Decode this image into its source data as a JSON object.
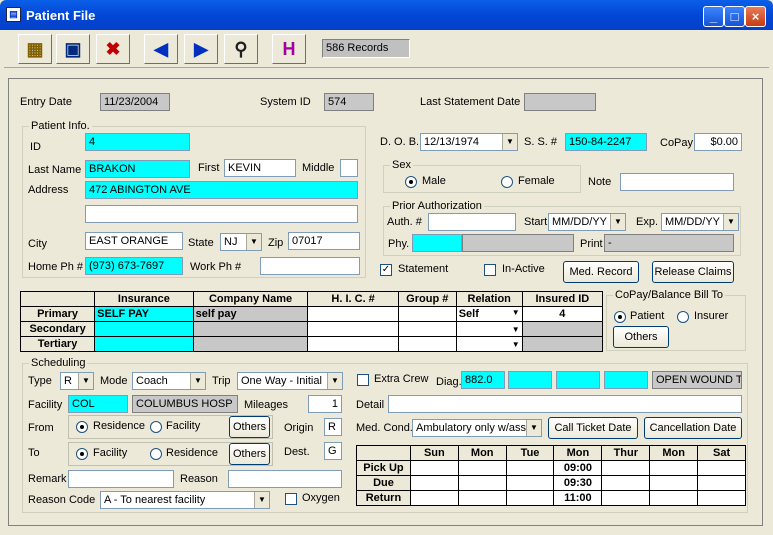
{
  "window": {
    "title": "Patient File"
  },
  "toolbar": {
    "records": "586 Records"
  },
  "header": {
    "entry_date_label": "Entry Date",
    "entry_date": "11/23/2004",
    "system_id_label": "System ID",
    "system_id": "574",
    "last_stmt_label": "Last Statement Date",
    "last_stmt": ""
  },
  "patient": {
    "group": "Patient Info.",
    "id_label": "ID",
    "id": "4",
    "last_name_label": "Last Name",
    "last_name": "BRAKON",
    "first_label": "First",
    "first": "KEVIN",
    "middle_label": "Middle",
    "middle": "",
    "address_label": "Address",
    "address1": "472 ABINGTON AVE",
    "address2": "",
    "city_label": "City",
    "city": "EAST ORANGE",
    "state_label": "State",
    "state": "NJ",
    "zip_label": "Zip",
    "zip": "07017",
    "home_ph_label": "Home Ph #",
    "home_ph": "(973) 673-7697",
    "work_ph_label": "Work Ph #",
    "work_ph": ""
  },
  "right": {
    "dob_label": "D. O. B.",
    "dob": "12/13/1974",
    "ss_label": "S. S. #",
    "ss": "150-84-2247",
    "copay_label": "CoPay",
    "copay": "$0.00",
    "sex_group": "Sex",
    "male": "Male",
    "female": "Female",
    "note_label": "Note",
    "note": "",
    "prior_group": "Prior Authorization",
    "auth_label": "Auth. #",
    "auth": "",
    "start_label": "Start",
    "start": "MM/DD/YY",
    "exp_label": "Exp.",
    "exp": "MM/DD/YY",
    "phy_label": "Phy.",
    "print_label": "Print",
    "print": "-",
    "statement": "Statement",
    "inactive": "In-Active",
    "med_record": "Med. Record",
    "release_claims": "Release Claims"
  },
  "insurance": {
    "headers": [
      "",
      "Insurance",
      "Company Name",
      "H. I. C. #",
      "Group #",
      "Relation",
      "Insured ID"
    ],
    "rows": [
      {
        "type": "Primary",
        "insurance": "SELF PAY",
        "company": "self pay",
        "hic": "",
        "group": "",
        "relation": "Self",
        "insured_id": "4"
      },
      {
        "type": "Secondary",
        "insurance": "",
        "company": "",
        "hic": "",
        "group": "",
        "relation": "",
        "insured_id": ""
      },
      {
        "type": "Tertiary",
        "insurance": "",
        "company": "",
        "hic": "",
        "group": "",
        "relation": "",
        "insured_id": ""
      }
    ]
  },
  "copay_bill": {
    "group": "CoPay/Balance Bill To",
    "patient": "Patient",
    "insurer": "Insurer",
    "others": "Others"
  },
  "scheduling": {
    "group": "Scheduling",
    "type_label": "Type",
    "type": "R",
    "mode_label": "Mode",
    "mode": "Coach",
    "trip_label": "Trip",
    "trip": "One Way - Initial",
    "extra_crew": "Extra Crew",
    "diag_label": "Diag.",
    "diag": "882.0",
    "diag_desc": "OPEN WOUND T",
    "facility_label": "Facility",
    "facility_code": "COL",
    "facility_name": "COLUMBUS HOSP",
    "mileages_label": "Mileages",
    "mileages": "1",
    "detail_label": "Detail",
    "detail": "",
    "from_label": "From",
    "residence": "Residence",
    "facility": "Facility",
    "others": "Others",
    "origin_label": "Origin",
    "origin": "R",
    "med_cond_label": "Med. Cond.",
    "med_cond": "Ambulatory only  w/ass",
    "call_ticket_date": "Call Ticket Date",
    "cancellation_date": "Cancellation Date",
    "to_label": "To",
    "dest_label": "Dest.",
    "dest": "G",
    "remark_label": "Remark",
    "remark": "",
    "reason_label": "Reason",
    "reason": "",
    "reason_code_label": "Reason Code",
    "reason_code": "A - To nearest facility",
    "oxygen": "Oxygen",
    "days": [
      "",
      "Sun",
      "Mon",
      "Tue",
      "Mon",
      "Thur",
      "Mon",
      "Sat"
    ],
    "rows": [
      {
        "label": "Pick Up",
        "values": [
          "",
          "",
          "",
          "09:00",
          "",
          "",
          ""
        ]
      },
      {
        "label": "Due",
        "values": [
          "",
          "",
          "",
          "09:30",
          "",
          "",
          ""
        ]
      },
      {
        "label": "Return",
        "values": [
          "",
          "",
          "",
          "11:00",
          "",
          "",
          ""
        ]
      }
    ]
  }
}
